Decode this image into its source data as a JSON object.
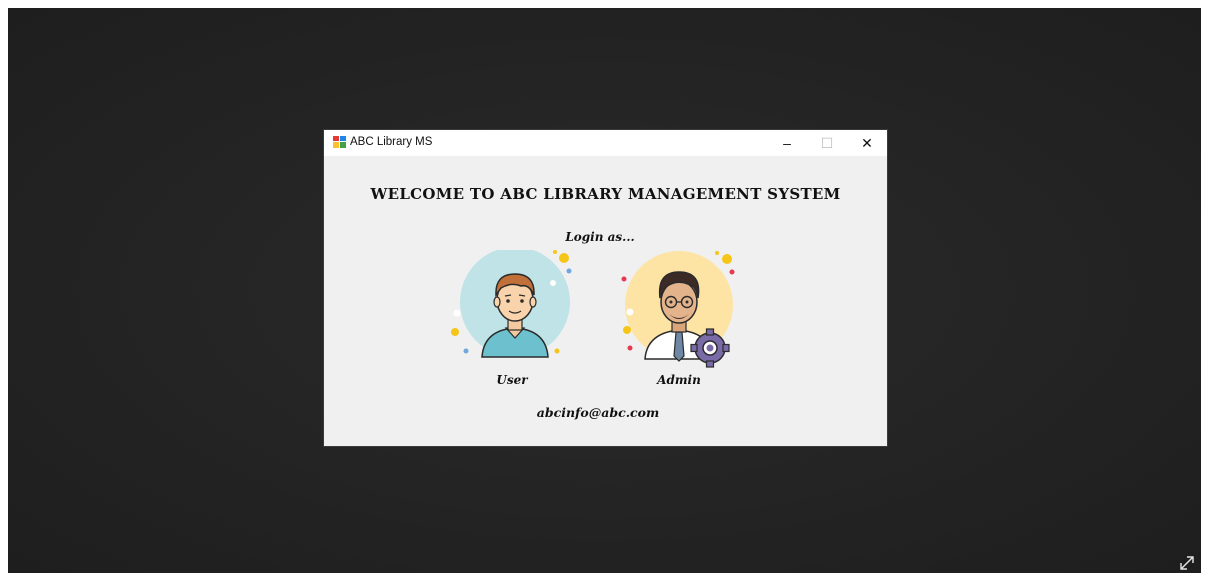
{
  "window": {
    "title": "ABC Library MS",
    "controls": {
      "minimize": "–",
      "maximize": "☐",
      "close": "✕"
    }
  },
  "main": {
    "heading": "WELCOME TO ABC LIBRARY MANAGEMENT SYSTEM",
    "prompt": "Login as...",
    "options": {
      "user_label": "User",
      "admin_label": "Admin"
    },
    "email": "abcinfo@abc.com"
  },
  "icons": {
    "app": "app-icon",
    "user_avatar": "user-avatar-icon",
    "admin_avatar": "admin-avatar-icon",
    "expand": "expand-icon"
  },
  "colors": {
    "backdrop": "#232323",
    "window_bg": "#f0f0f0",
    "titlebar_bg": "#ffffff",
    "user_circle": "#bfe3e6",
    "admin_circle": "#fde3a4"
  }
}
